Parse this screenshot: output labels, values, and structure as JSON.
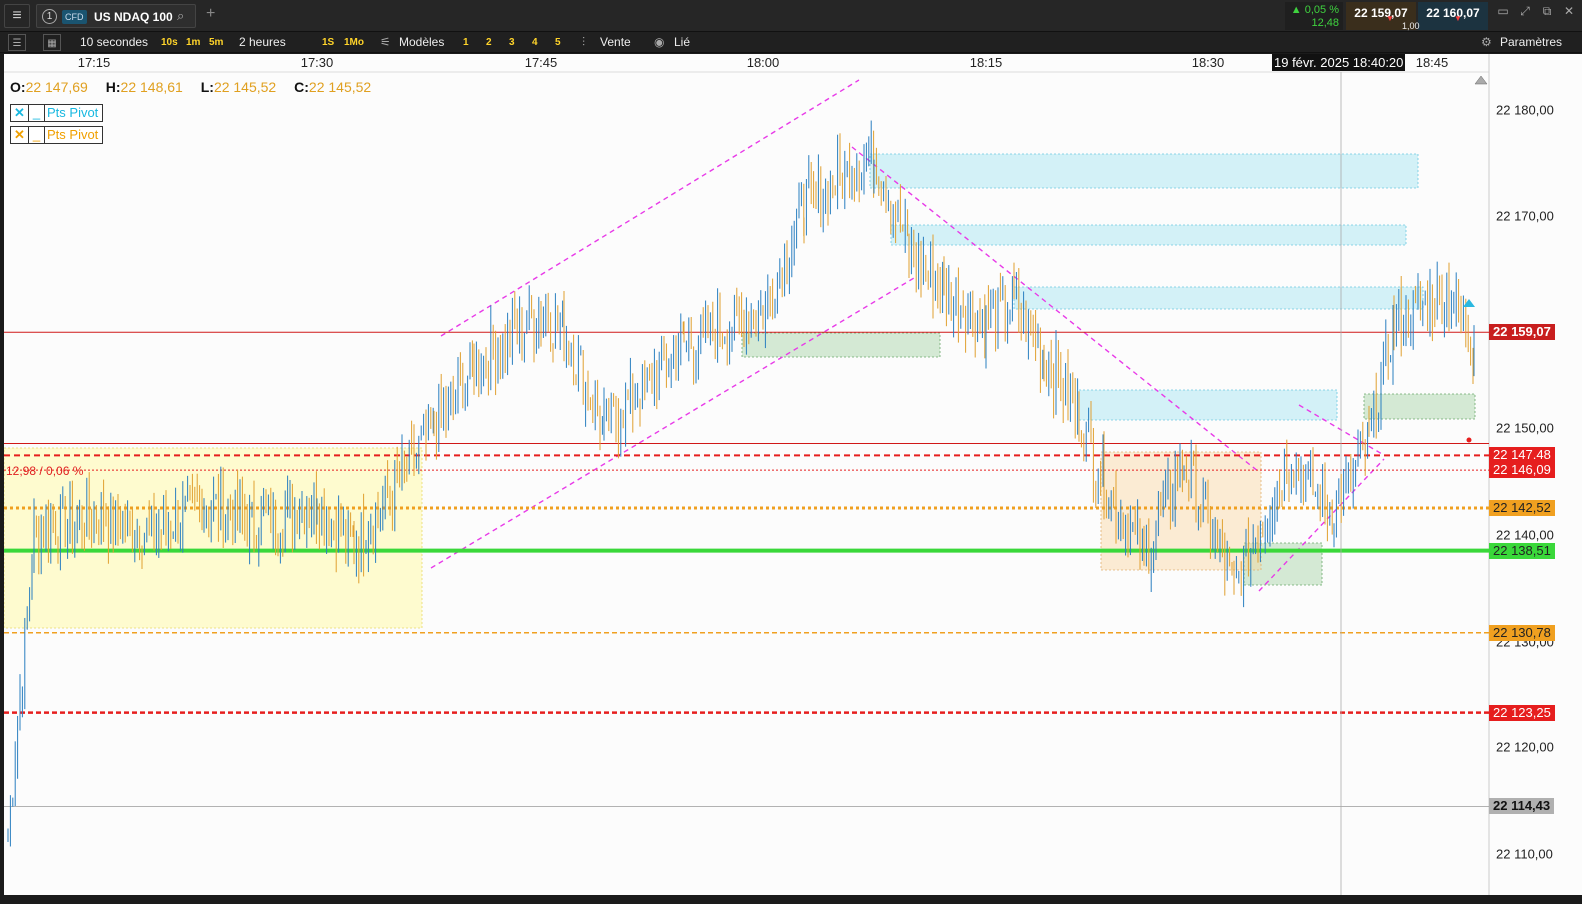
{
  "topbar": {
    "menu_icon": "hamburger-icon",
    "tab_number": "1",
    "tab_badge": "CFD",
    "symbol": "US NDAQ 100",
    "search_icon": "search-icon",
    "add_icon": "plus-icon",
    "change_pct": "▲ 0,05 %",
    "change_pts": "12,48",
    "bid": "22 159,07",
    "ask": "22 160,07",
    "spread": "1,00",
    "window_icons": [
      "restore-icon",
      "expand-icon",
      "popout-icon",
      "close-icon"
    ]
  },
  "toolbar": {
    "interval": "10 secondes",
    "quick_intervals": [
      "10s",
      "1m",
      "5m"
    ],
    "period": "2 heures",
    "quick_periods": [
      "1S",
      "1Mo"
    ],
    "templates_label": "Modèles",
    "layouts": [
      "1",
      "2",
      "3",
      "4",
      "5"
    ],
    "sell_label": "Vente",
    "linked_label": "Lié",
    "settings_label": "Paramètres"
  },
  "chart": {
    "ohlc": {
      "o_label": "O:",
      "o": "22 147,69",
      "h_label": "H:",
      "h": "22 148,61",
      "l_label": "L:",
      "l": "22 145,52",
      "c_label": "C:",
      "c": "22 145,52"
    },
    "pivot_label": "Pts Pivot",
    "crosshair_date": "19 févr. 2025 18:40:20",
    "range_label": "12,98 / 0,06 %",
    "x_ticks": [
      "17:15",
      "17:30",
      "17:45",
      "18:00",
      "18:15",
      "18:30",
      "18:45"
    ],
    "y_ticks": [
      "22 180,00",
      "22 170,00",
      "22 150,00",
      "22 140,00",
      "22 130,00",
      "22 120,00",
      "22 110,00"
    ],
    "price_badges": [
      {
        "text": "22 159,07",
        "value": 22159.07,
        "color": "#c81e1e"
      },
      {
        "text": "22 147.48",
        "value": 22147.48,
        "color": "#e61e1e"
      },
      {
        "text": "22 146,09",
        "value": 22146.09,
        "color": "#e61e1e"
      },
      {
        "text": "22 142,52",
        "value": 22142.52,
        "color": "#f0a020"
      },
      {
        "text": "22 138,51",
        "value": 22138.51,
        "color": "#3ad83a"
      },
      {
        "text": "22 130,78",
        "value": 22130.78,
        "color": "#f0a020"
      },
      {
        "text": "22 123,25",
        "value": 22123.25,
        "color": "#e61e1e"
      },
      {
        "text": "22 114,43",
        "value": 22114.43,
        "color": "#b0b0b0"
      }
    ]
  },
  "chart_data": {
    "type": "line",
    "title": "",
    "xlabel": "",
    "ylabel": "",
    "x": [
      "17:08",
      "17:10",
      "17:15",
      "17:20",
      "17:25",
      "17:30",
      "17:35",
      "17:38",
      "17:40",
      "17:42",
      "17:45",
      "17:47",
      "17:50",
      "17:55",
      "18:00",
      "18:03",
      "18:07",
      "18:10",
      "18:13",
      "18:15",
      "18:18",
      "18:20",
      "18:23",
      "18:25",
      "18:28",
      "18:30",
      "18:32",
      "18:35",
      "18:38",
      "18:40",
      "18:43",
      "18:45",
      "18:47"
    ],
    "series": [
      {
        "values": [
          22112,
          22140,
          22142,
          22140,
          22143,
          22141,
          22143,
          22139,
          22150,
          22156,
          22161,
          22159,
          22150,
          22158,
          22161,
          22171,
          22176,
          22167,
          22163,
          22160,
          22162,
          22157,
          22151,
          22145,
          22138,
          22147,
          22135,
          22147,
          22142,
          22149,
          22160,
          22163,
          22158
        ]
      }
    ],
    "ylim": [
      22107,
      22184
    ],
    "grid": false
  }
}
